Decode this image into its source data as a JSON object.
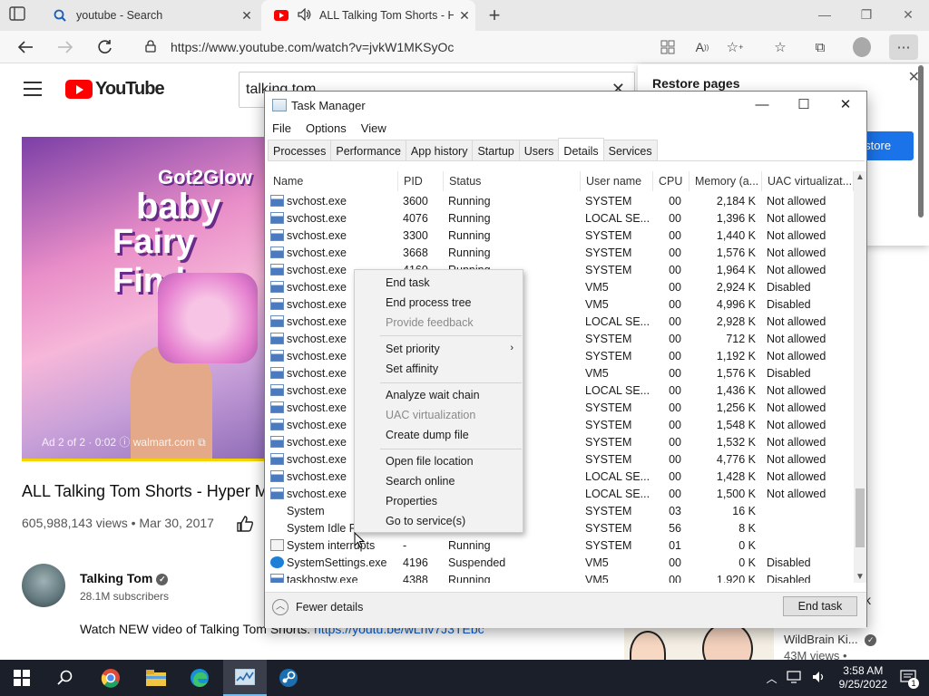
{
  "browser": {
    "tabs": [
      {
        "title": "youtube - Search",
        "icon": "search-icon"
      },
      {
        "title": "ALL Talking Tom Shorts - Hç",
        "icon": "youtube-icon"
      }
    ],
    "url": "https://www.youtube.com/watch?v=jvkW1MKSyOc"
  },
  "youtube": {
    "logo_text": "YouTube",
    "search_value": "talking tom",
    "video_title": "ALL Talking Tom Shorts - Hyper M",
    "views_date": "605,988,143 views • Mar 30, 2017",
    "ad_overlay": "Ad 2 of 2 · 0:02 ⓘ walmart.com ⧉",
    "thumb_brand": [
      "Got2Glow",
      "baby",
      "Fairy Find"
    ],
    "channel_name": "Talking Tom",
    "channel_subs": "28.1M subscribers",
    "description_text": "Watch NEW video of Talking Tom Shorts: ",
    "description_link": "https://youtu.be/wLhv7J3TEbc",
    "restore_title": "Restore pages",
    "restore_button": "estore",
    "side_video_channel": "WildBrain Ki...",
    "side_video_views": "43M views •",
    "side_text": "k"
  },
  "task_manager": {
    "title": "Task Manager",
    "menu": [
      "File",
      "Options",
      "View"
    ],
    "tabs": [
      "Processes",
      "Performance",
      "App history",
      "Startup",
      "Users",
      "Details",
      "Services"
    ],
    "active_tab": "Details",
    "columns": [
      "Name",
      "PID",
      "Status",
      "User name",
      "CPU",
      "Memory (a...",
      "UAC virtualizat..."
    ],
    "rows": [
      {
        "name": "svchost.exe",
        "pid": "3600",
        "status": "Running",
        "user": "SYSTEM",
        "cpu": "00",
        "mem": "2,184 K",
        "uac": "Not allowed",
        "icon": "process-icon"
      },
      {
        "name": "svchost.exe",
        "pid": "4076",
        "status": "Running",
        "user": "LOCAL SE...",
        "cpu": "00",
        "mem": "1,396 K",
        "uac": "Not allowed",
        "icon": "process-icon"
      },
      {
        "name": "svchost.exe",
        "pid": "3300",
        "status": "Running",
        "user": "SYSTEM",
        "cpu": "00",
        "mem": "1,440 K",
        "uac": "Not allowed",
        "icon": "process-icon"
      },
      {
        "name": "svchost.exe",
        "pid": "3668",
        "status": "Running",
        "user": "SYSTEM",
        "cpu": "00",
        "mem": "1,576 K",
        "uac": "Not allowed",
        "icon": "process-icon"
      },
      {
        "name": "svchost.exe",
        "pid": "4160",
        "status": "Running",
        "user": "SYSTEM",
        "cpu": "00",
        "mem": "1,964 K",
        "uac": "Not allowed",
        "icon": "process-icon"
      },
      {
        "name": "svchost.exe",
        "pid": "",
        "status": "",
        "user": "VM5",
        "cpu": "00",
        "mem": "2,924 K",
        "uac": "Disabled",
        "icon": "process-icon"
      },
      {
        "name": "svchost.exe",
        "pid": "",
        "status": "",
        "user": "VM5",
        "cpu": "00",
        "mem": "4,996 K",
        "uac": "Disabled",
        "icon": "process-icon"
      },
      {
        "name": "svchost.exe",
        "pid": "",
        "status": "",
        "user": "LOCAL SE...",
        "cpu": "00",
        "mem": "2,928 K",
        "uac": "Not allowed",
        "icon": "process-icon"
      },
      {
        "name": "svchost.exe",
        "pid": "",
        "status": "",
        "user": "SYSTEM",
        "cpu": "00",
        "mem": "712 K",
        "uac": "Not allowed",
        "icon": "process-icon"
      },
      {
        "name": "svchost.exe",
        "pid": "",
        "status": "",
        "user": "SYSTEM",
        "cpu": "00",
        "mem": "1,192 K",
        "uac": "Not allowed",
        "icon": "process-icon"
      },
      {
        "name": "svchost.exe",
        "pid": "",
        "status": "",
        "user": "VM5",
        "cpu": "00",
        "mem": "1,576 K",
        "uac": "Disabled",
        "icon": "process-icon"
      },
      {
        "name": "svchost.exe",
        "pid": "",
        "status": "",
        "user": "LOCAL SE...",
        "cpu": "00",
        "mem": "1,436 K",
        "uac": "Not allowed",
        "icon": "process-icon"
      },
      {
        "name": "svchost.exe",
        "pid": "",
        "status": "",
        "user": "SYSTEM",
        "cpu": "00",
        "mem": "1,256 K",
        "uac": "Not allowed",
        "icon": "process-icon"
      },
      {
        "name": "svchost.exe",
        "pid": "",
        "status": "",
        "user": "SYSTEM",
        "cpu": "00",
        "mem": "1,548 K",
        "uac": "Not allowed",
        "icon": "process-icon"
      },
      {
        "name": "svchost.exe",
        "pid": "",
        "status": "",
        "user": "SYSTEM",
        "cpu": "00",
        "mem": "1,532 K",
        "uac": "Not allowed",
        "icon": "process-icon"
      },
      {
        "name": "svchost.exe",
        "pid": "",
        "status": "",
        "user": "SYSTEM",
        "cpu": "00",
        "mem": "4,776 K",
        "uac": "Not allowed",
        "icon": "process-icon"
      },
      {
        "name": "svchost.exe",
        "pid": "",
        "status": "",
        "user": "LOCAL SE...",
        "cpu": "00",
        "mem": "1,428 K",
        "uac": "Not allowed",
        "icon": "process-icon"
      },
      {
        "name": "svchost.exe",
        "pid": "",
        "status": "",
        "user": "LOCAL SE...",
        "cpu": "00",
        "mem": "1,500 K",
        "uac": "Not allowed",
        "icon": "process-icon"
      },
      {
        "name": "System",
        "pid": "",
        "status": "",
        "user": "SYSTEM",
        "cpu": "03",
        "mem": "16 K",
        "uac": "",
        "icon": "none"
      },
      {
        "name": "System Idle Pro",
        "pid": "",
        "status": "",
        "user": "SYSTEM",
        "cpu": "56",
        "mem": "8 K",
        "uac": "",
        "icon": "none"
      },
      {
        "name": "System interrupts",
        "pid": "-",
        "status": "Running",
        "user": "SYSTEM",
        "cpu": "01",
        "mem": "0 K",
        "uac": "",
        "icon": "plain-icon"
      },
      {
        "name": "SystemSettings.exe",
        "pid": "4196",
        "status": "Suspended",
        "user": "VM5",
        "cpu": "00",
        "mem": "0 K",
        "uac": "Disabled",
        "icon": "settings-gear-icon"
      },
      {
        "name": "taskhostw.exe",
        "pid": "4388",
        "status": "Running",
        "user": "VM5",
        "cpu": "00",
        "mem": "1,920 K",
        "uac": "Disabled",
        "icon": "process-icon"
      }
    ],
    "fewer_details": "Fewer details",
    "end_task_button": "End task"
  },
  "context_menu": {
    "items": [
      {
        "label": "End task",
        "disabled": false
      },
      {
        "label": "End process tree",
        "disabled": false
      },
      {
        "label": "Provide feedback",
        "disabled": true
      },
      {
        "label": "Set priority",
        "disabled": false,
        "submenu": true
      },
      {
        "label": "Set affinity",
        "disabled": false
      },
      {
        "label": "Analyze wait chain",
        "disabled": false
      },
      {
        "label": "UAC virtualization",
        "disabled": true
      },
      {
        "label": "Create dump file",
        "disabled": false
      },
      {
        "label": "Open file location",
        "disabled": false
      },
      {
        "label": "Search online",
        "disabled": false
      },
      {
        "label": "Properties",
        "disabled": false
      },
      {
        "label": "Go to service(s)",
        "disabled": false
      }
    ]
  },
  "taskbar": {
    "time": "3:58 AM",
    "date": "9/25/2022",
    "notifications": "1"
  },
  "colors": {
    "youtube_red": "#ff0000",
    "taskbar_bg": "#1b1f2a",
    "link_blue": "#065fd4",
    "edge_accent": "#1a73e8"
  }
}
